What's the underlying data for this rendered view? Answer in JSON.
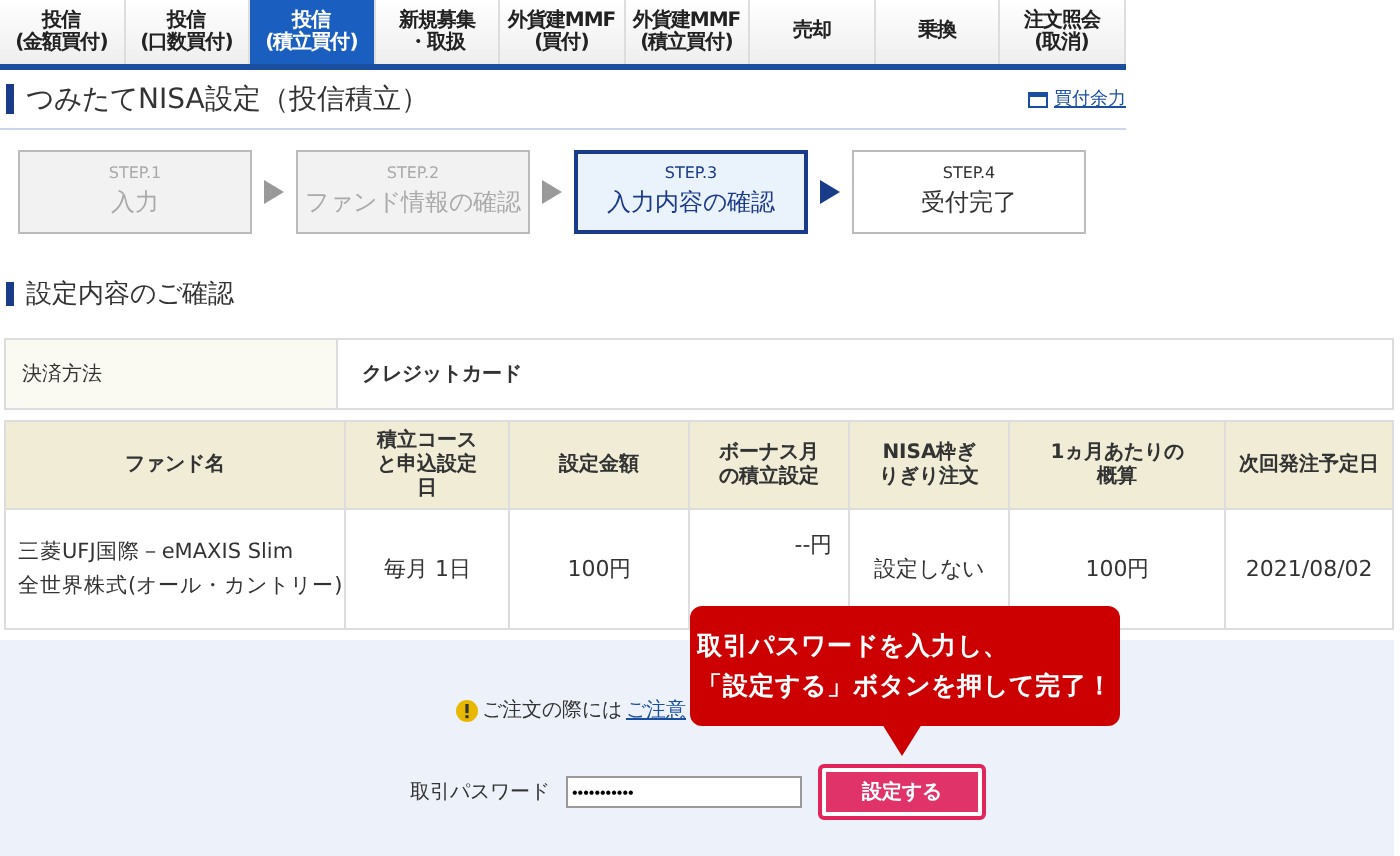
{
  "tabs": [
    {
      "lines": [
        "投信",
        "(金額買付)"
      ],
      "selected": false
    },
    {
      "lines": [
        "投信",
        "(口数買付)"
      ],
      "selected": false
    },
    {
      "lines": [
        "投信",
        "(積立買付)"
      ],
      "selected": true
    },
    {
      "lines": [
        "新規募集",
        "・取扱"
      ],
      "selected": false
    },
    {
      "lines": [
        "外貨建MMF",
        "(買付)"
      ],
      "selected": false
    },
    {
      "lines": [
        "外貨建MMF",
        "(積立買付)"
      ],
      "selected": false
    },
    {
      "lines": [
        "売却"
      ],
      "selected": false
    },
    {
      "lines": [
        "乗換"
      ],
      "selected": false
    },
    {
      "lines": [
        "注文照会",
        "(取消)"
      ],
      "selected": false
    }
  ],
  "page_title": "つみたてNISA設定（投信積立）",
  "buying_power_link": "買付余力",
  "steps": [
    {
      "step": "STEP.1",
      "label": "入力",
      "completed": true,
      "selected": false
    },
    {
      "step": "STEP.2",
      "label": "ファンド情報の確認",
      "completed": true,
      "selected": false
    },
    {
      "step": "STEP.3",
      "label": "入力内容の確認",
      "completed": false,
      "selected": true
    },
    {
      "step": "STEP.4",
      "label": "受付完了",
      "completed": false,
      "selected": false
    }
  ],
  "section_title": "設定内容のご確認",
  "payment": {
    "label": "決済方法",
    "value": "クレジットカード"
  },
  "table": {
    "columns": [
      "ファンド名",
      "積立コースと申込設定日",
      "設定金額",
      "ボーナス月の積立設定",
      "NISA枠ぎりぎり注文",
      "1ヵ月あたりの概算",
      "次回発注予定日"
    ],
    "rows": [
      {
        "cells": [
          "三菱UFJ国際－eMAXIS Slim\n全世界株式(オール・カントリー)",
          "毎月 1日",
          "100円",
          "--円",
          "設定しない",
          "100円",
          "2021/08/02"
        ]
      }
    ]
  },
  "notice": {
    "text": "ご注文の際には",
    "link": "ご注意"
  },
  "password": {
    "label": "取引パスワード",
    "value": "•••••••••••"
  },
  "submit_button": "設定する",
  "callout": [
    "取引パスワードを入力し、",
    "「設定する」ボタンを押して完了！"
  ]
}
